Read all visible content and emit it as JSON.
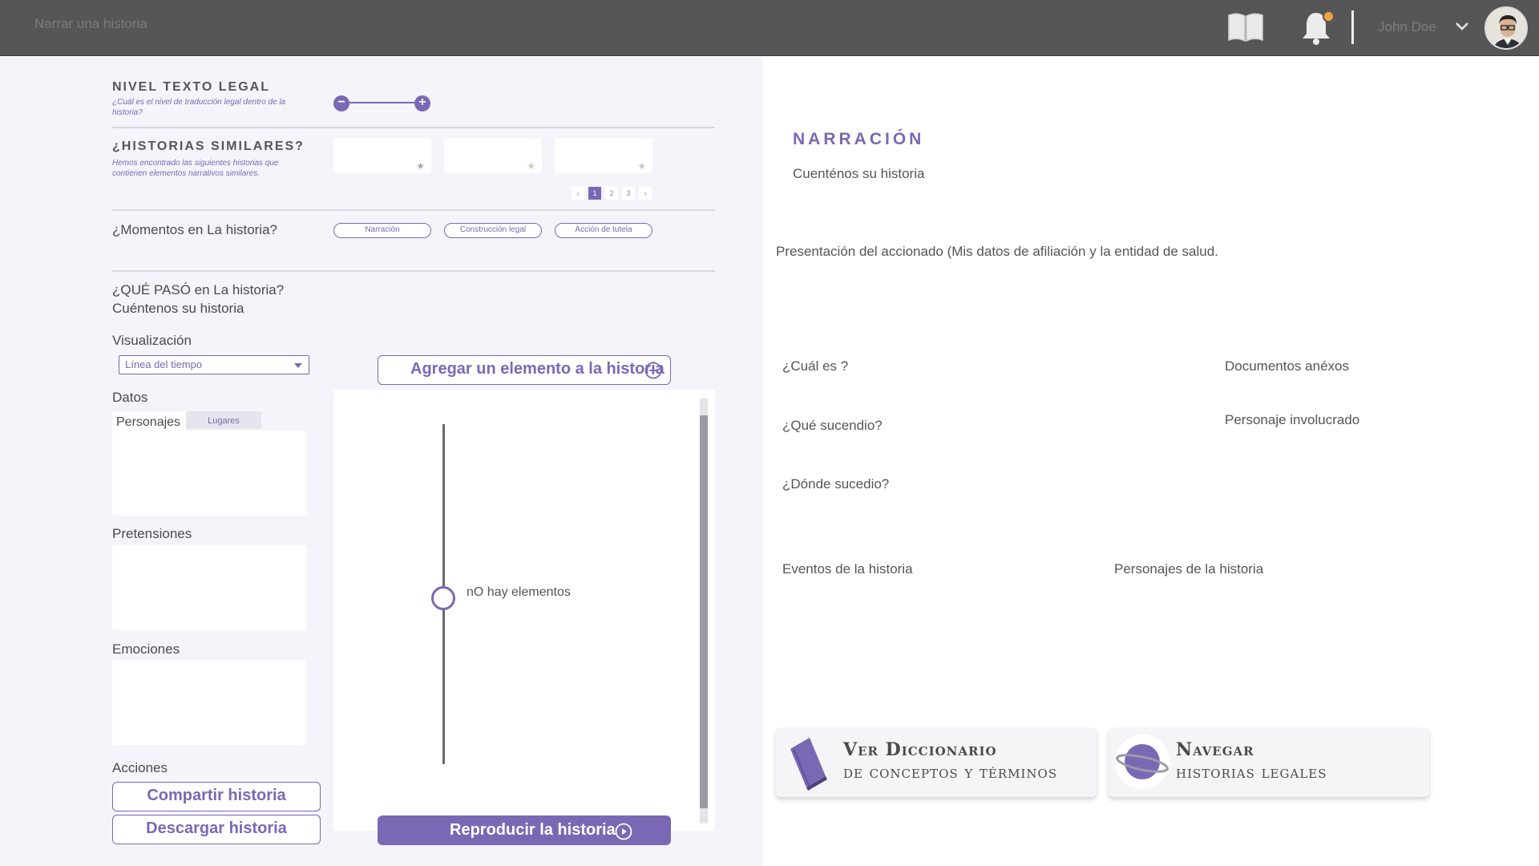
{
  "header": {
    "app_title": "Narrar una historia",
    "user_name": "John Doe",
    "notification_color": "#f4a13a"
  },
  "nivel": {
    "title": "NIVEL TEXTO LEGAL",
    "subtitle": "¿Cuál es el nivel de traducción legal dentro de la historia?",
    "minus": "−",
    "plus": "+"
  },
  "similares": {
    "title": "¿HISTORIAS SIMILARES?",
    "subtitle": "Hemos encontrado las siguientes historias que contienen elementos narrativos similares.",
    "star_glyph": "★",
    "pages": [
      "1",
      "2",
      "3"
    ],
    "prev": "‹",
    "next": "›"
  },
  "momentos": {
    "title": "¿Momentos en La historia?",
    "chips": [
      "Narración",
      "Construcción legal",
      "Acción de tutela"
    ]
  },
  "que_paso": {
    "title": "¿QUÉ PASÓ en La historia?",
    "subtitle": "Cuéntenos su historia"
  },
  "visualizacion": {
    "label": "Visualización",
    "selected": "Línea del tiempo"
  },
  "datos": {
    "label": "Datos",
    "tabs": [
      "Personajes",
      "Lugares"
    ],
    "pretensiones": "Pretensiones",
    "emociones": "Emociones"
  },
  "acciones": {
    "label": "Acciones",
    "share": "Compartir historia",
    "download": "Descargar historia"
  },
  "timeline": {
    "add_label": "Agregar un elemento a la historia",
    "empty_text": "nO hay elementos",
    "play_label": "Reproducir la historia"
  },
  "narracion": {
    "title": "NARRACIÓN",
    "subtitle": "Cuenténos su historia",
    "presentacion": "Presentación del accionado (Mis datos de afiliación y la entidad de salud.",
    "cual": "¿Cuál es ?",
    "que": "¿Qué sucendio?",
    "donde": "¿Dónde sucedio?",
    "documentos": "Documentos  anéxos",
    "personaje": "Personaje involucrado",
    "eventos": "Eventos de la historia",
    "personajes": "Personajes de la historia"
  },
  "cards": {
    "diccionario_title": "Ver Diccionario",
    "diccionario_sub": "de conceptos y términos",
    "navegar_title": "Navegar",
    "navegar_sub": "historias legales"
  },
  "colors": {
    "accent": "#7a68b4",
    "topbar": "#565656",
    "panel": "#f5f4fa"
  }
}
